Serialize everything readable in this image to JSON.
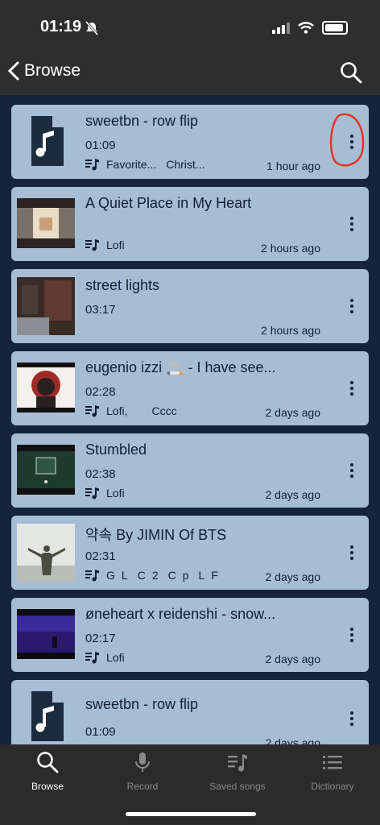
{
  "status": {
    "time": "01:19"
  },
  "header": {
    "back_label": "Browse"
  },
  "items": [
    {
      "title": "sweetbn - row flip",
      "duration": "01:09",
      "tags": [
        "Favorite...",
        "Christ..."
      ],
      "ago": "1 hour ago"
    },
    {
      "title": "A Quiet Place in My Heart",
      "duration": "",
      "tags": [
        "Lofi"
      ],
      "ago": "2 hours ago"
    },
    {
      "title": "street lights",
      "duration": "03:17",
      "tags": [],
      "ago": "2 hours ago"
    },
    {
      "title": "eugenio izzi 🚬 - I have see...",
      "duration": "02:28",
      "tags": [
        "Lofi,",
        "Cccc"
      ],
      "ago": "2 days ago"
    },
    {
      "title": "Stumbled",
      "duration": "02:38",
      "tags": [
        "Lofi"
      ],
      "ago": "2 days ago"
    },
    {
      "title": "약속 By JIMIN Of BTS",
      "duration": "02:31",
      "tags": [
        "G",
        "L",
        "C",
        "2",
        "C",
        "p",
        "L",
        "F"
      ],
      "ago": "2 days ago"
    },
    {
      "title": "øneheart x reidenshi - snow...",
      "duration": "02:17",
      "tags": [
        "Lofi"
      ],
      "ago": "2 days ago"
    },
    {
      "title": "sweetbn - row flip",
      "duration": "01:09",
      "tags": [],
      "ago": "2 days ago"
    }
  ],
  "tabs": [
    {
      "label": "Browse",
      "icon": "search-icon",
      "active": true
    },
    {
      "label": "Record",
      "icon": "microphone-icon",
      "active": false
    },
    {
      "label": "Saved songs",
      "icon": "music-list-icon",
      "active": false
    },
    {
      "label": "Dictionary",
      "icon": "list-icon",
      "active": false
    }
  ],
  "colors": {
    "card": "#a6bdd4",
    "list_bg": "#13243c",
    "topbar": "#2e2e2e",
    "annotation": "#e8321e"
  }
}
